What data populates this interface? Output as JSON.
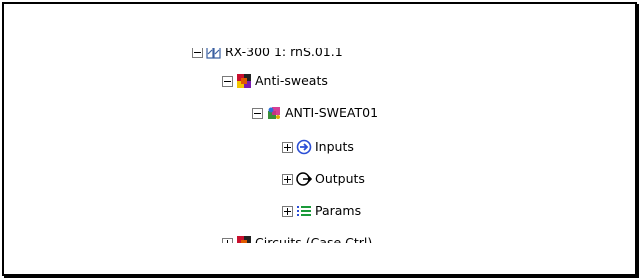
{
  "tree": {
    "root_label": "RX-300 1: rnS.01.1",
    "anti_sweats_label": "Anti-sweats",
    "anti_sweat01_label": "ANTI-SWEAT01",
    "inputs_label": "Inputs",
    "outputs_label": "Outputs",
    "params_label": "Params",
    "circuits_label": "Circuits (Case Ctrl)"
  },
  "colors": {
    "border": "#000000",
    "expander_border": "#7a7a7a",
    "inputs_icon": "#2b4fd6",
    "params_icon": "#1a9a3a"
  },
  "icons": {
    "root": "controller-icon",
    "anti_sweats": "folder-group-icon",
    "anti_sweat01": "device-icon",
    "inputs": "input-arrow-icon",
    "outputs": "output-arrow-icon",
    "params": "params-list-icon",
    "circuits": "folder-group-icon"
  }
}
